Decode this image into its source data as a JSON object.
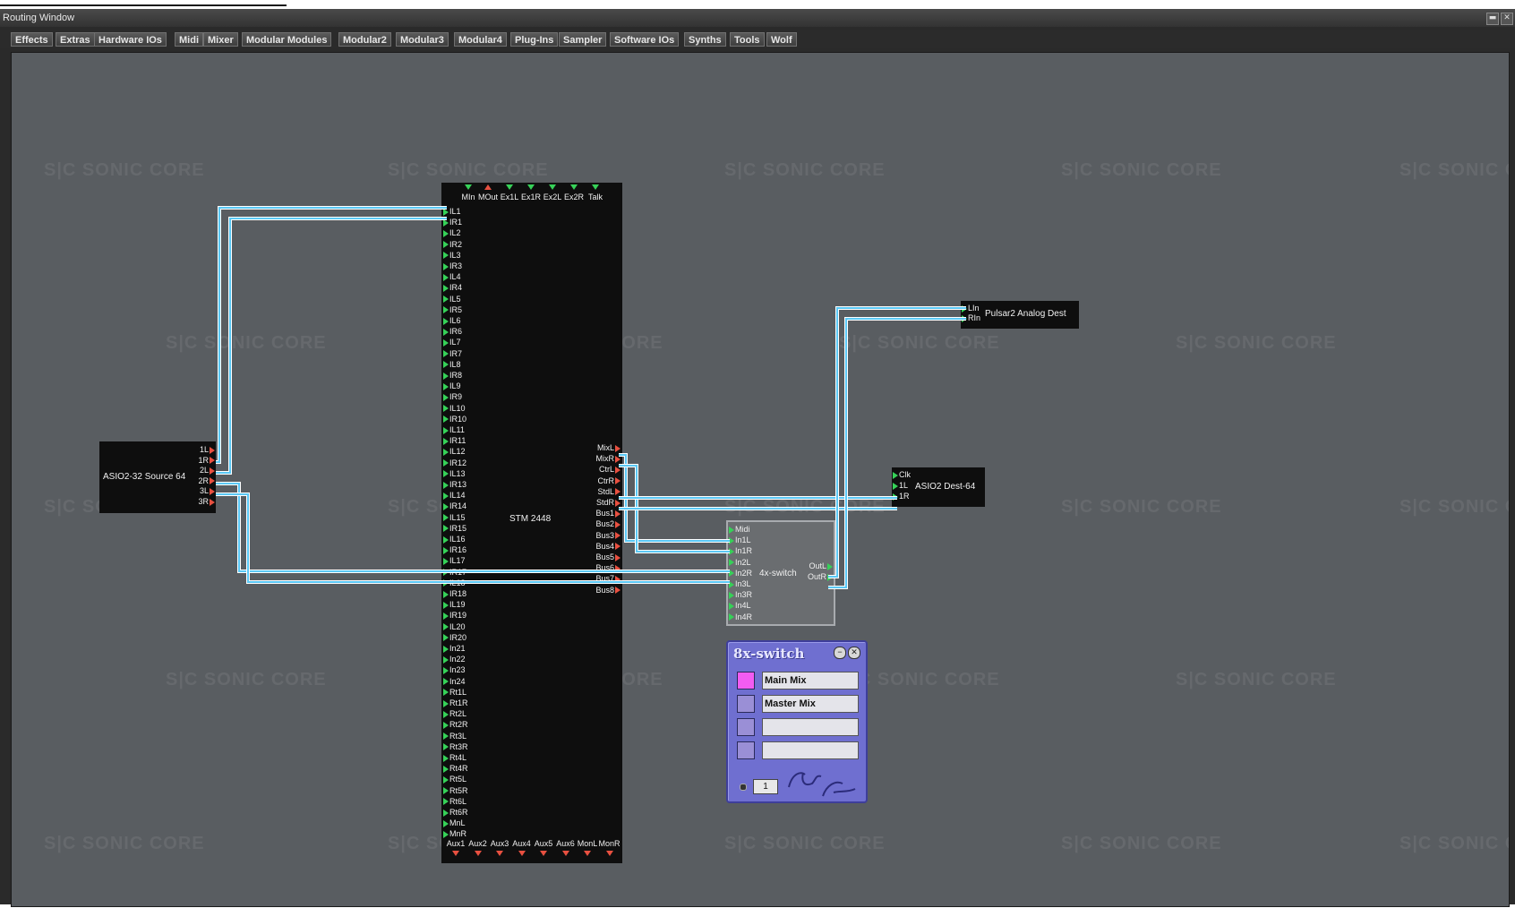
{
  "window": {
    "title": "Routing Window",
    "minimize_icon": "minimize-icon",
    "close_icon": "close-icon"
  },
  "menu": [
    "Effects",
    "Extras",
    "Hardware IOs",
    "Midi",
    "Mixer",
    "Modular Modules",
    "Modular2",
    "Modular3",
    "Modular4",
    "Plug-Ins",
    "Sampler",
    "Software IOs",
    "Synths",
    "Tools",
    "Wolf"
  ],
  "watermark": "S|C SONIC CORE",
  "wire_color": "#5bc8f5",
  "modules": {
    "asio_source": {
      "name": "ASIO2-32 Source 64",
      "outputs": [
        "1L",
        "1R",
        "2L",
        "2R",
        "3L",
        "3R"
      ]
    },
    "stm": {
      "name": "STM 2448",
      "top_ports": [
        "MIn",
        "MOut",
        "Ex1L",
        "Ex1R",
        "Ex2L",
        "Ex2R",
        "Talk"
      ],
      "inputs": [
        "IL1",
        "IR1",
        "IL2",
        "IR2",
        "IL3",
        "IR3",
        "IL4",
        "IR4",
        "IL5",
        "IR5",
        "IL6",
        "IR6",
        "IL7",
        "IR7",
        "IL8",
        "IR8",
        "IL9",
        "IR9",
        "IL10",
        "IR10",
        "IL11",
        "IR11",
        "IL12",
        "IR12",
        "IL13",
        "IR13",
        "IL14",
        "IR14",
        "IL15",
        "IR15",
        "IL16",
        "IR16",
        "IL17",
        "IR17",
        "IL18",
        "IR18",
        "IL19",
        "IR19",
        "IL20",
        "IR20",
        "In21",
        "In22",
        "In23",
        "In24",
        "Rt1L",
        "Rt1R",
        "Rt2L",
        "Rt2R",
        "Rt3L",
        "Rt3R",
        "Rt4L",
        "Rt4R",
        "Rt5L",
        "Rt5R",
        "Rt6L",
        "Rt6R",
        "MnL",
        "MnR"
      ],
      "outputs": [
        "MixL",
        "MixR",
        "CtrL",
        "CtrR",
        "StdL",
        "StdR",
        "Bus1",
        "Bus2",
        "Bus3",
        "Bus4",
        "Bus5",
        "Bus6",
        "Bus7",
        "Bus8"
      ],
      "bottom_ports": [
        "Aux1",
        "Aux2",
        "Aux3",
        "Aux4",
        "Aux5",
        "Aux6",
        "MonL",
        "MonR"
      ]
    },
    "pulsar_dest": {
      "name": "Pulsar2 Analog Dest",
      "inputs": [
        "LIn",
        "RIn"
      ]
    },
    "asio_dest": {
      "name": "ASIO2 Dest-64",
      "inputs": [
        "Clk",
        "1L",
        "1R"
      ]
    },
    "switch4x": {
      "name": "4x-switch",
      "inputs": [
        "Midi",
        "In1L",
        "In1R",
        "In2L",
        "In2R",
        "In3L",
        "In3R",
        "In4L",
        "In4R"
      ],
      "outputs": [
        "OutL",
        "OutR"
      ]
    }
  },
  "panel8x": {
    "title": "8x-switch",
    "minimize_icon": "minimize-icon",
    "close_icon": "close-icon",
    "slots": [
      {
        "label": "Main Mix",
        "color": "#f25cf2"
      },
      {
        "label": "Master Mix",
        "color": "#9a8fd6"
      },
      {
        "label": "",
        "color": "#9a8fd6"
      },
      {
        "label": "",
        "color": "#9a8fd6"
      }
    ],
    "counter": "1",
    "logo_icon": "curve-logo-icon"
  }
}
